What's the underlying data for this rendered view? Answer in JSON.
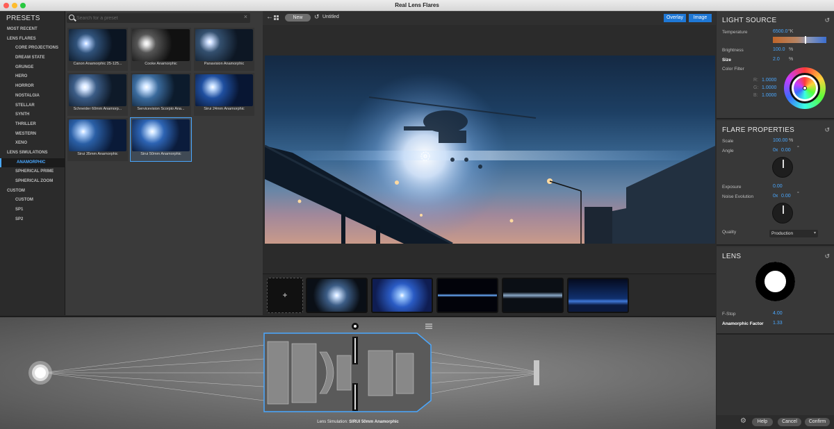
{
  "window": {
    "title": "Real Lens Flares"
  },
  "presets": {
    "title": "PRESETS",
    "items": [
      {
        "label": "MOST RECENT",
        "level": 0
      },
      {
        "label": "LENS FLARES",
        "level": 0
      },
      {
        "label": "CORE PROJECTIONS",
        "level": 1
      },
      {
        "label": "DREAM STATE",
        "level": 1
      },
      {
        "label": "GRUNGE",
        "level": 1
      },
      {
        "label": "HERO",
        "level": 1
      },
      {
        "label": "HORROR",
        "level": 1
      },
      {
        "label": "NOSTALGIA",
        "level": 1
      },
      {
        "label": "STELLAR",
        "level": 1
      },
      {
        "label": "SYNTH",
        "level": 1
      },
      {
        "label": "THRILLER",
        "level": 1
      },
      {
        "label": "WESTERN",
        "level": 1
      },
      {
        "label": "XENO",
        "level": 1
      },
      {
        "label": "LENS SIMULATIONS",
        "level": 0
      },
      {
        "label": "ANAMORPHIC",
        "level": 1,
        "selected": true
      },
      {
        "label": "SPHERICAL PRIME",
        "level": 1
      },
      {
        "label": "SPHERICAL ZOOM",
        "level": 1
      },
      {
        "label": "CUSTOM",
        "level": 0
      },
      {
        "label": "CUSTOM",
        "level": 1
      },
      {
        "label": "SP1",
        "level": 1
      },
      {
        "label": "SP2",
        "level": 1
      }
    ]
  },
  "browser": {
    "search_placeholder": "Search for a preset",
    "clear_glyph": "×",
    "thumbnails": [
      {
        "label": "Canon Anamorphic 25-125..."
      },
      {
        "label": "Cooke Anamorphic"
      },
      {
        "label": "Panavision Anamorphic"
      },
      {
        "label": "Schneider 60mm Anamorp..."
      },
      {
        "label": "Servicevision Scorpio Ana..."
      },
      {
        "label": "Sirui 24mm Anamorphic"
      },
      {
        "label": "Sirui 35mm Anamorphic"
      },
      {
        "label": "Sirui 50mm Anamorphic",
        "selected": true
      }
    ]
  },
  "toolbar": {
    "back_glyph": "←",
    "new_label": "New",
    "reset_glyph": "↺",
    "document_name": "Untitled",
    "overlay_label": "Overlay",
    "image_label": "Image"
  },
  "strip": {
    "add_glyph": "+"
  },
  "lens_sim": {
    "caption_prefix": "Lens Simulation:",
    "caption_value": "SIRUI 50mm Anamorphic"
  },
  "light_source": {
    "title": "LIGHT SOURCE",
    "reset_glyph": "↺",
    "temperature": {
      "label": "Temperature",
      "value": "6500.0",
      "unit": "°K"
    },
    "brightness": {
      "label": "Brightness",
      "value": "100.0",
      "unit": "%"
    },
    "size": {
      "label": "Size",
      "value": "2.0",
      "unit": "%"
    },
    "color_filter": {
      "label": "Color Filter",
      "r_label": "R:",
      "r": "1.0000",
      "g_label": "G:",
      "g": "1.0000",
      "b_label": "B:",
      "b": "1.0000"
    }
  },
  "flare_properties": {
    "title": "FLARE PROPERTIES",
    "reset_glyph": "↺",
    "scale": {
      "label": "Scale",
      "value": "100.00",
      "unit": "%"
    },
    "angle": {
      "label": "Angle",
      "turns": "0x",
      "value": "0.00",
      "unit": "°"
    },
    "exposure": {
      "label": "Exposure",
      "value": "0.00"
    },
    "noise": {
      "label": "Noise Evolution",
      "turns": "0x",
      "value": "0.00",
      "unit": "°"
    },
    "quality": {
      "label": "Quality",
      "value": "Production",
      "chev": "▾"
    }
  },
  "lens": {
    "title": "LENS",
    "reset_glyph": "↺",
    "fstop": {
      "label": "F-Stop",
      "value": "4.00"
    },
    "anamorphic": {
      "label": "Anamorphic Factor",
      "value": "1.33"
    }
  },
  "footer": {
    "help": "Help",
    "cancel": "Cancel",
    "confirm": "Confirm"
  },
  "colors": {
    "accent": "#4aa8ff",
    "button_blue": "#1f78d6"
  }
}
